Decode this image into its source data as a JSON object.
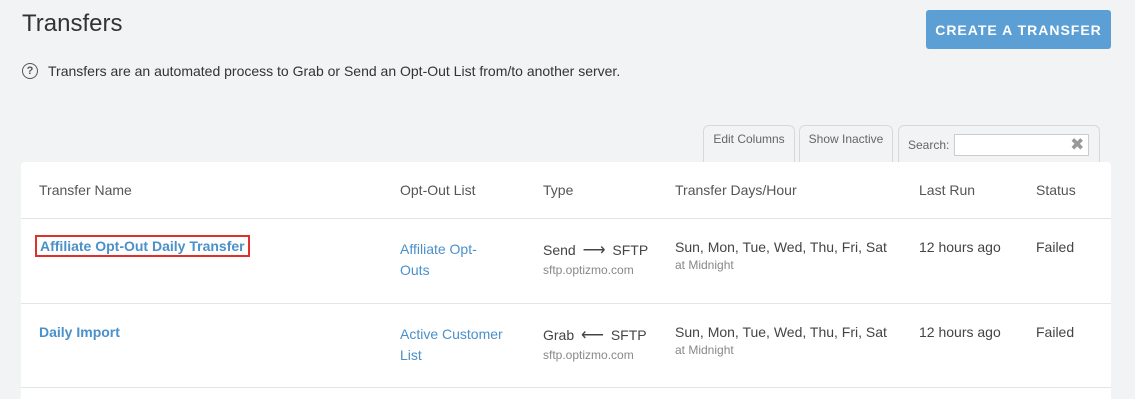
{
  "page": {
    "title": "Transfers",
    "create_button": "CREATE A TRANSFER",
    "info_text": "Transfers are an automated process to Grab or Send an Opt-Out List from/to another server."
  },
  "toolbar": {
    "edit_columns": "Edit Columns",
    "show_inactive": "Show Inactive",
    "search_label": "Search:",
    "search_value": ""
  },
  "table": {
    "headers": {
      "name": "Transfer Name",
      "optout": "Opt-Out List",
      "type": "Type",
      "days": "Transfer Days/Hour",
      "last_run": "Last Run",
      "status": "Status"
    },
    "rows": [
      {
        "name": "Affiliate Opt-Out Daily Transfer",
        "optout_line1": "Affiliate Opt-",
        "optout_line2": "Outs",
        "type_action": "Send",
        "type_arrow": "⟶",
        "type_protocol": "SFTP",
        "type_host": "sftp.optizmo.com",
        "days": "Sun, Mon, Tue, Wed, Thu, Fri, Sat",
        "hour": "at Midnight",
        "last_run": "12 hours ago",
        "status": "Failed"
      },
      {
        "name": "Daily Import",
        "optout_line1": "Active Customer",
        "optout_line2": "List",
        "type_action": "Grab",
        "type_arrow": "⟵",
        "type_protocol": "SFTP",
        "type_host": "sftp.optizmo.com",
        "days": "Sun, Mon, Tue, Wed, Thu, Fri, Sat",
        "hour": "at Midnight",
        "last_run": "12 hours ago",
        "status": "Failed"
      }
    ]
  },
  "colors": {
    "accent": "#5b9fd4",
    "link": "#4a90c9",
    "highlight": "#e0302c"
  }
}
